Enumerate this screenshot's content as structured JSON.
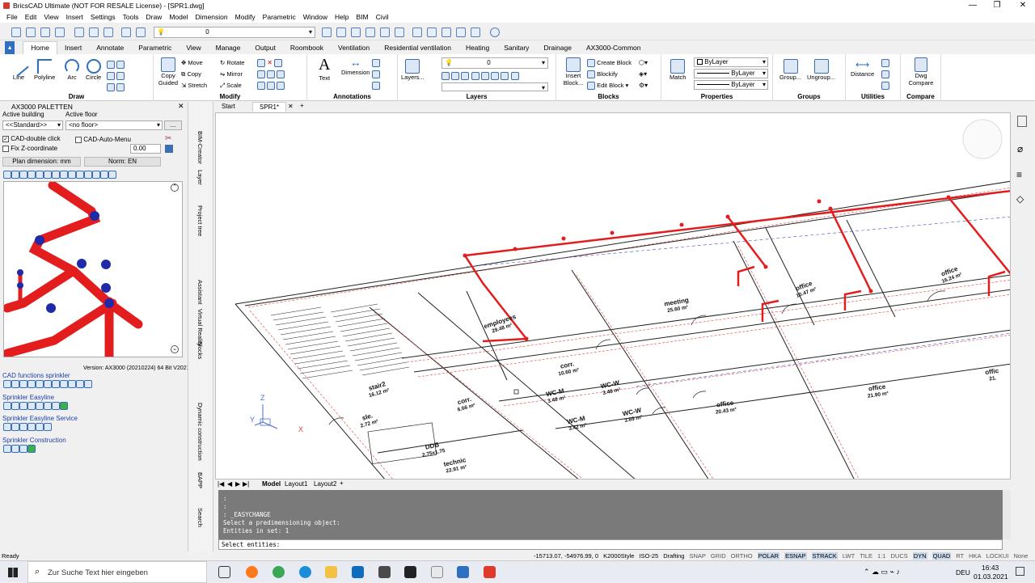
{
  "window": {
    "title": "BricsCAD Ultimate (NOT FOR RESALE License) - [SPR1.dwg]"
  },
  "menu": [
    "File",
    "Edit",
    "View",
    "Insert",
    "Settings",
    "Tools",
    "Draw",
    "Model",
    "Dimension",
    "Modify",
    "Parametric",
    "Window",
    "Help",
    "BIM",
    "Civil"
  ],
  "qat": {
    "layer_value": "0"
  },
  "ribbon": {
    "tabs": [
      "Home",
      "Insert",
      "Annotate",
      "Parametric",
      "View",
      "Manage",
      "Output",
      "Roombook",
      "Ventilation",
      "Residential ventilation",
      "Heating",
      "Sanitary",
      "Drainage",
      "AX3000-Common"
    ],
    "draw": {
      "label": "Draw",
      "line": "Line",
      "polyline": "Polyline",
      "arc": "Arc",
      "circle": "Circle"
    },
    "modify": {
      "label": "Modify",
      "copy_guided": "Copy Guided",
      "move": "Move",
      "copy": "Copy",
      "stretch": "Stretch",
      "rotate": "Rotate",
      "mirror": "Mirror",
      "scale": "Scale"
    },
    "annotations": {
      "label": "Annotations",
      "text": "Text",
      "dimension": "Dimension"
    },
    "layers": {
      "label": "Layers",
      "layers_btn": "Layers...",
      "current": "0"
    },
    "blocks": {
      "label": "Blocks",
      "insert": "Insert Block...",
      "create": "Create Block",
      "blockify": "Blockify",
      "edit": "Edit Block"
    },
    "properties": {
      "label": "Properties",
      "match": "Match",
      "color": "ByLayer",
      "linetype": "ByLayer",
      "lineweight": "ByLayer"
    },
    "groups": {
      "label": "Groups",
      "group": "Group...",
      "ungroup": "Ungroup..."
    },
    "utilities": {
      "label": "Utilities",
      "distance": "Distance"
    },
    "compare": {
      "label": "Compare",
      "dwg_compare": "Dwg Compare"
    }
  },
  "palette": {
    "title": "AX3000 PALETTEN",
    "active_building_label": "Active building",
    "active_floor_label": "Active floor",
    "building_value": "<<Standard>>",
    "floor_value": "<no floor>",
    "cad_double_click": "CAD-double click",
    "cad_auto_menu": "CAD-Auto-Menu",
    "fix_z": "Fix Z-coordinate",
    "z_value": "0.00",
    "plan_dimension": "Plan dimension: mm",
    "norm": "Norm: EN",
    "version": "Version: AX3000 (20210224) 64 Bit V2021",
    "sections": [
      "CAD functions sprinkler",
      "Sprinkler Easyline",
      "Sprinkler Easyline Service",
      "Sprinkler Construction"
    ]
  },
  "side_tabs": [
    "BIM-Creator",
    "Layer",
    "Project tree",
    "Assistant",
    "Virtual Reality",
    "Blocks",
    "Dynamic construction",
    "BAPP",
    "Search"
  ],
  "doc_tabs": [
    "Start",
    "SPR1*"
  ],
  "layout_tabs": [
    "Model",
    "Layout1",
    "Layout2"
  ],
  "drawing": {
    "rooms": [
      {
        "name": "employees",
        "area": "29.48 m²"
      },
      {
        "name": "meeting",
        "area": "25.60 m²"
      },
      {
        "name": "office",
        "area": "10.47 m²"
      },
      {
        "name": "office",
        "area": "16.24 m²"
      },
      {
        "name": "corr.",
        "area": "10.60 m²"
      },
      {
        "name": "WC-M",
        "area": "3.48 m²"
      },
      {
        "name": "WC-W",
        "area": "3.48 m²"
      },
      {
        "name": "WC-M",
        "area": "3.42 m²"
      },
      {
        "name": "WC-W",
        "area": "3.69 m²"
      },
      {
        "name": "stair2",
        "area": "16.12 m²"
      },
      {
        "name": "corr.",
        "area": "6.66 m²"
      },
      {
        "name": "sle.",
        "area": "2.72 m²"
      },
      {
        "name": "DDB",
        "area": "2.75x1.75"
      },
      {
        "name": "technic",
        "area": "22.91 m²"
      },
      {
        "name": "office",
        "area": "20.43 m²"
      },
      {
        "name": "office",
        "area": "21.90 m²"
      },
      {
        "name": "offic",
        "area": "21."
      }
    ],
    "ucs": {
      "x": "X",
      "y": "Y",
      "z": "Z"
    }
  },
  "command": {
    "lines": [
      ":",
      ":",
      ": _EASYCHANGE",
      "Select a predimensioning object:",
      "Entities in set: 1"
    ],
    "prompt": "Select entities:"
  },
  "status": {
    "ready": "Ready",
    "coords": "-15713.07, -54976.99, 0",
    "style": "K2000Style",
    "dimstyle": "ISO-25",
    "workspace": "Drafting",
    "toggles": [
      {
        "l": "SNAP",
        "on": false
      },
      {
        "l": "GRID",
        "on": false
      },
      {
        "l": "ORTHO",
        "on": false
      },
      {
        "l": "POLAR",
        "on": true
      },
      {
        "l": "ESNAP",
        "on": true
      },
      {
        "l": "STRACK",
        "on": true
      },
      {
        "l": "LWT",
        "on": false
      },
      {
        "l": "TILE",
        "on": false
      },
      {
        "l": "1:1",
        "on": false
      },
      {
        "l": "DUCS",
        "on": false
      },
      {
        "l": "DYN",
        "on": true
      },
      {
        "l": "QUAD",
        "on": true
      },
      {
        "l": "RT",
        "on": false
      },
      {
        "l": "HKA",
        "on": false
      },
      {
        "l": "LOCKUI",
        "on": false
      },
      {
        "l": "None",
        "on": false
      }
    ]
  },
  "taskbar": {
    "search": "Zur Suche Text hier eingeben",
    "lang": "DEU",
    "time": "16:43",
    "date": "01.03.2021"
  }
}
